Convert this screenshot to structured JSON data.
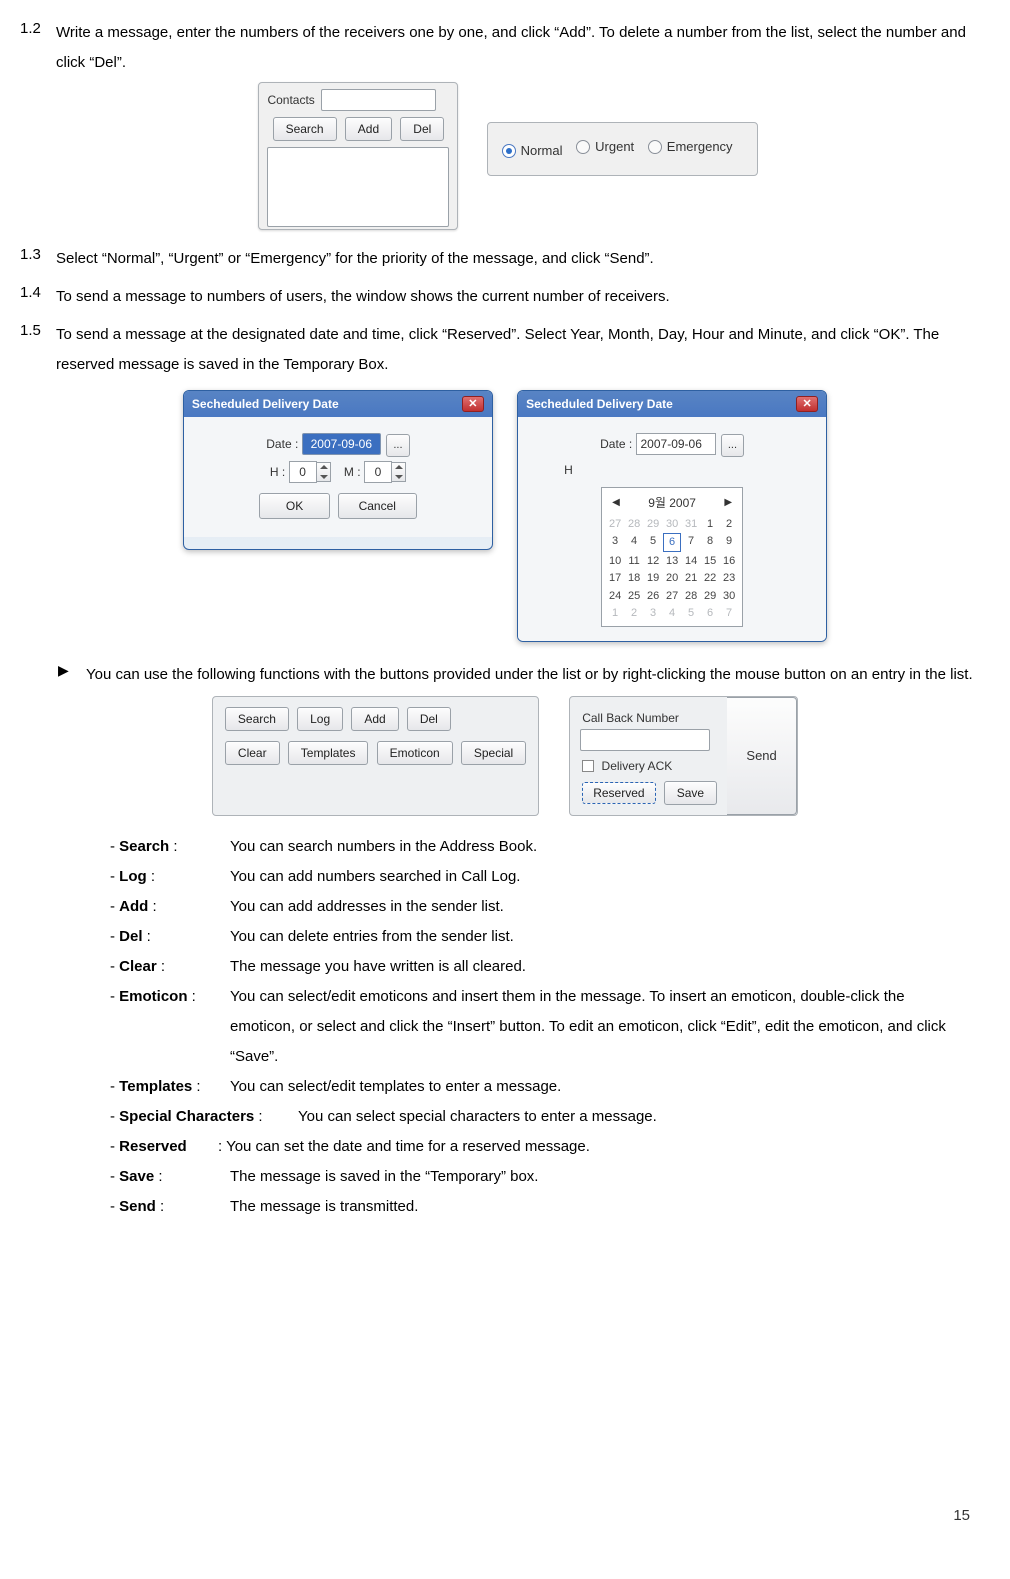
{
  "sections": {
    "s12": {
      "num": "1.2",
      "text": "Write a message, enter the numbers of the receivers one by one, and click “Add”. To delete a number from the list, select the number and click “Del”."
    },
    "s13": {
      "num": "1.3",
      "text": "Select “Normal”, “Urgent” or “Emergency” for the priority of the message, and click “Send”."
    },
    "s14": {
      "num": "1.4",
      "text": "To send a message to numbers of users, the window shows the current number of receivers."
    },
    "s15": {
      "num": "1.5",
      "text": "To send a message at the designated date and time, click “Reserved”. Select Year, Month, Day, Hour and Minute, and click “OK”. The reserved message is saved in the Temporary Box."
    }
  },
  "contacts_panel": {
    "contacts_label": "Contacts",
    "search_btn": "Search",
    "add_btn": "Add",
    "del_btn": "Del"
  },
  "priority": {
    "normal": "Normal",
    "urgent": "Urgent",
    "emergency": "Emergency"
  },
  "scheduled": {
    "title": "Secheduled Delivery Date",
    "date_label": "Date :",
    "date_value": "2007-09-06",
    "hour_label": "H :",
    "hour_value": "0",
    "min_label": "M :",
    "min_value": "0",
    "ok_btn": "OK",
    "cancel_btn": "Cancel",
    "more_btn": "...",
    "calendar_month": "9월  2007"
  },
  "calendar_days": {
    "r0": [
      "27",
      "28",
      "29",
      "30",
      "31",
      "1",
      "2"
    ],
    "r1": [
      "3",
      "4",
      "5",
      "6",
      "7",
      "8",
      "9"
    ],
    "r2": [
      "10",
      "11",
      "12",
      "13",
      "14",
      "15",
      "16"
    ],
    "r3": [
      "17",
      "18",
      "19",
      "20",
      "21",
      "22",
      "23"
    ],
    "r4": [
      "24",
      "25",
      "26",
      "27",
      "28",
      "29",
      "30"
    ],
    "r5": [
      "1",
      "2",
      "3",
      "4",
      "5",
      "6",
      "7"
    ]
  },
  "arrow_note": "You can use the following functions with the buttons provided under the list or by right-clicking the mouse button on an entry in the list.",
  "fn_buttons": {
    "search": "Search",
    "log": "Log",
    "add": "Add",
    "del": "Del",
    "clear": "Clear",
    "templates": "Templates",
    "emoticon": "Emoticon",
    "special": "Special"
  },
  "send_panel": {
    "callback_label": "Call Back Number",
    "delivery_ack": "Delivery ACK",
    "reserved_btn": "Reserved",
    "save_btn": "Save",
    "send_btn": "Send"
  },
  "descriptions": {
    "search": "You can search numbers in the Address Book.",
    "log": "You can add numbers searched in Call Log.",
    "add": "You can add addresses in the sender list.",
    "del": "You can delete entries from the sender list.",
    "clear": "The message you have written is all cleared.",
    "emoticon": "You can select/edit emoticons and insert them in the message. To insert an emoticon, double-click the emoticon, or select and click the “Insert” button. To edit an emoticon, click “Edit”, edit the emoticon, and click “Save”.",
    "templates": "You can select/edit templates to enter a message.",
    "special": "You can select special characters to enter a message.",
    "reserved": ": You can set the date and time for a reserved message.",
    "save": "The message is saved in the “Temporary” box.",
    "send": "The message is transmitted."
  },
  "labels": {
    "search": "Search",
    "log": "Log",
    "add": "Add",
    "del": "Del",
    "clear": "Clear",
    "emoticon": "Emoticon",
    "templates": "Templates",
    "special": "Special Characters",
    "reserved": "Reserved",
    "save": "Save",
    "send": "Send"
  },
  "page_number": "15"
}
